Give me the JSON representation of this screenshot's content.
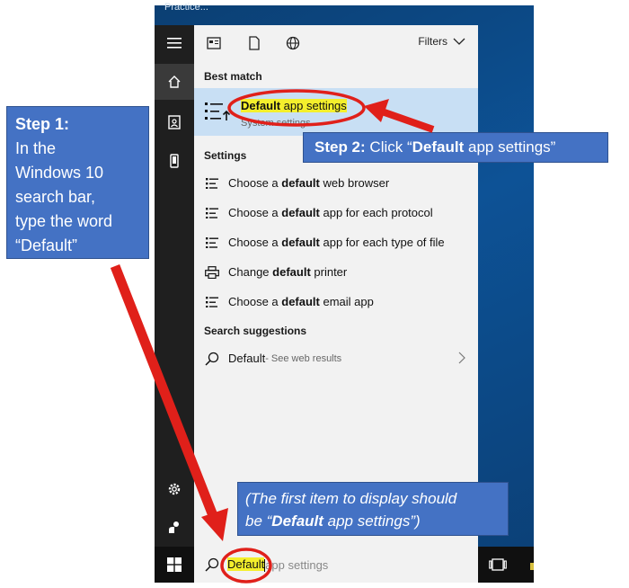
{
  "window": {
    "title_fragment": "Practice..."
  },
  "rail": {
    "items": [
      {
        "name": "menu",
        "icon": "hamburger-icon"
      },
      {
        "name": "home",
        "icon": "home-icon"
      },
      {
        "name": "documents",
        "icon": "document-icon"
      },
      {
        "name": "device",
        "icon": "device-icon"
      },
      {
        "name": "settings",
        "icon": "gear-icon"
      },
      {
        "name": "feedback",
        "icon": "feedback-icon"
      }
    ]
  },
  "toolbar": {
    "icons": [
      "apps-icon",
      "document-icon",
      "globe-icon"
    ],
    "filters_label": "Filters"
  },
  "best_match": {
    "header": "Best match",
    "title_bold": "Default",
    "title_rest": " app settings",
    "subtitle": "System settings"
  },
  "settings": {
    "header": "Settings",
    "items": [
      {
        "pre": "Choose a ",
        "bold": "default",
        "post": " web browser",
        "icon": "list-settings-icon"
      },
      {
        "pre": "Choose a ",
        "bold": "default",
        "post": " app for each protocol",
        "icon": "list-settings-icon"
      },
      {
        "pre": "Choose a ",
        "bold": "default",
        "post": " app for each type of file",
        "icon": "list-settings-icon"
      },
      {
        "pre": "Change ",
        "bold": "default",
        "post": " printer",
        "icon": "printer-icon"
      },
      {
        "pre": "Choose a ",
        "bold": "default",
        "post": " email app",
        "icon": "list-settings-icon"
      }
    ]
  },
  "suggestions": {
    "header": "Search suggestions",
    "item": {
      "term": "Default",
      "sub": " - See web results"
    }
  },
  "searchbox": {
    "typed": "Default",
    "ghost": "app settings"
  },
  "annotations": {
    "step1": {
      "bold": "Step 1:",
      "line1": "In the",
      "line2": "Windows 10",
      "line3": "search bar,",
      "line4": "type the word",
      "line5": "“Default”"
    },
    "step2": {
      "bold": "Step 2:",
      "pre": " Click “",
      "bold2": "Default",
      "post": " app settings”"
    },
    "step3": {
      "pre": "(The first item to display should",
      "line2_pre": "be “",
      "bold": "Default",
      "post": " app settings”)"
    }
  },
  "colors": {
    "rail": "#1f1f1f",
    "panel": "#f2f2f2",
    "selection": "#c8dff4",
    "highlight": "#f4ef2c",
    "callout": "#4472c4",
    "annotation_red": "#e0201a"
  }
}
